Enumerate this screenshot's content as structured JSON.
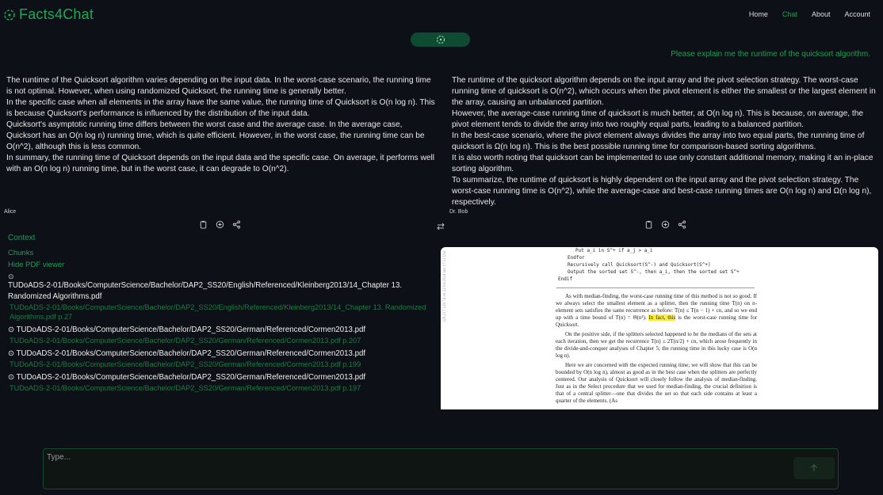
{
  "app": {
    "title": "Facts4Chat"
  },
  "nav": {
    "items": [
      "Home",
      "Chat",
      "About",
      "Account"
    ],
    "active": "Chat"
  },
  "question": "Please explain me the runtime of the quicksort algorithm.",
  "answers": {
    "left": {
      "paragraphs": [
        "The runtime of the Quicksort algorithm varies depending on the input data. In the worst-case scenario, the running time is not optimal. However, when using randomized Quicksort, the running time is generally better.",
        "In the specific case when all elements in the array have the same value, the running time of Quicksort is O(n log n). This is because Quicksort's performance is influenced by the distribution of the input data.",
        "Quicksort's asymptotic running time differs between the worst case and the average case. In the average case, Quicksort has an O(n log n) running time, which is quite efficient. However, in the worst case, the running time can be O(n^2), although this is less common.",
        "In summary, the running time of Quicksort depends on the input data and the specific case. On average, it performs well with an O(n log n) running time, but in the worst case, it can degrade to O(n^2)."
      ],
      "author": "Alice"
    },
    "right": {
      "paragraphs": [
        "The runtime of the quicksort algorithm depends on the input array and the pivot selection strategy. The worst-case running time of quicksort is O(n^2), which occurs when the pivot element is either the smallest or the largest element in the array, causing an unbalanced partition.",
        "However, the average-case running time of quicksort is much better, at O(n log n). This is because, on average, the pivot element tends to divide the array into two roughly equal parts, leading to a balanced partition.",
        "In the best-case scenario, where the pivot element always divides the array into two equal parts, the running time of quicksort is Ω(n log n). This is the best possible running time for comparison-based sorting algorithms.",
        "It is also worth noting that quicksort can be implemented to use only constant additional memory, making it an in-place sorting algorithm.",
        "To summarize, the runtime of quicksort is highly dependent on the input array and the pivot selection strategy. The worst-case running time is O(n^2), while the average-case and best-case running times are O(n log n) and Ω(n log n), respectively."
      ],
      "author": "Dr. Bob"
    }
  },
  "context": {
    "title": "Context",
    "chunks_label": "Chunks",
    "hide_pdf_label": "Hide PDF viewer",
    "files": [
      {
        "path": "TUDoADS-2-01/Books/ComputerScience/Bachelor/DAP2_SS20/English/Referenced/Kleinberg2013/14_Chapter 13. Randomized Algorithms.pdf",
        "source": "TUDoADS-2-01/Books/ComputerScience/Bachelor/DAP2_SS20/English/Referenced/Kleinberg2013/14_Chapter 13. Randomized Algorithms.pdf p.27"
      },
      {
        "path": "TUDoADS-2-01/Books/ComputerScience/Bachelor/DAP2_SS20/German/Referenced/Cormen2013.pdf",
        "source": "TUDoADS-2-01/Books/ComputerScience/Bachelor/DAP2_SS20/German/Referenced/Cormen2013.pdf p.207"
      },
      {
        "path": "TUDoADS-2-01/Books/ComputerScience/Bachelor/DAP2_SS20/German/Referenced/Cormen2013.pdf",
        "source": "TUDoADS-2-01/Books/ComputerScience/Bachelor/DAP2_SS20/German/Referenced/Cormen2013.pdf p.199"
      },
      {
        "path": "TUDoADS-2-01/Books/ComputerScience/Bachelor/DAP2_SS20/German/Referenced/Cormen2013.pdf",
        "source": "TUDoADS-2-01/Books/ComputerScience/Bachelor/DAP2_SS20/German/Referenced/Cormen2013.pdf p.197"
      }
    ]
  },
  "pdf": {
    "code_lines": [
      "Put a_i in S^+ if a_j > a_i",
      "Endfor",
      "Recursively call Quicksort(S^-) and Quicksort(S^+)",
      "Output the sorted set S^-, then a_i, then the sorted set S^+",
      "Endif"
    ],
    "p1_before": "As with median-finding, the worst-case running time of this method is not so good. If we always select the smallest element as a splitter, then the running time T(n) on n-element sets satisfies the same recurrence as before: T(n) ≤ T(n − 1) + cn, and so we end up with a time bound of T(n) = Θ(n²).",
    "p1_highlight": "In fact, this",
    "p1_after": "is the worst-case running time for Quicksort.",
    "p2": "On the positive side, if the splitters selected happened to be the medians of the sets at each iteration, then we get the recurrence T(n) ≤ 2T(n/2) + cn, which arose frequently in the divide-and-conquer analyses of Chapter 5; the running time in this lucky case is O(n log n).",
    "p3": "Here we are concerned with the expected running time; we will show that this can be bounded by O(n log n), almost as good as in the best case when the splitters are perfectly centered. Our analysis of Quicksort will closely follow the analysis of median-finding. Just as in the Select procedure that we used for median-finding, the crucial definition is that of a central splitter—one that divides the set so that each side contains at least a quarter of the elements. (As",
    "side_stamp": "129.217.129.74 on 22.04.2024 um 17:12 Uhr"
  },
  "input": {
    "placeholder": "Type..."
  }
}
